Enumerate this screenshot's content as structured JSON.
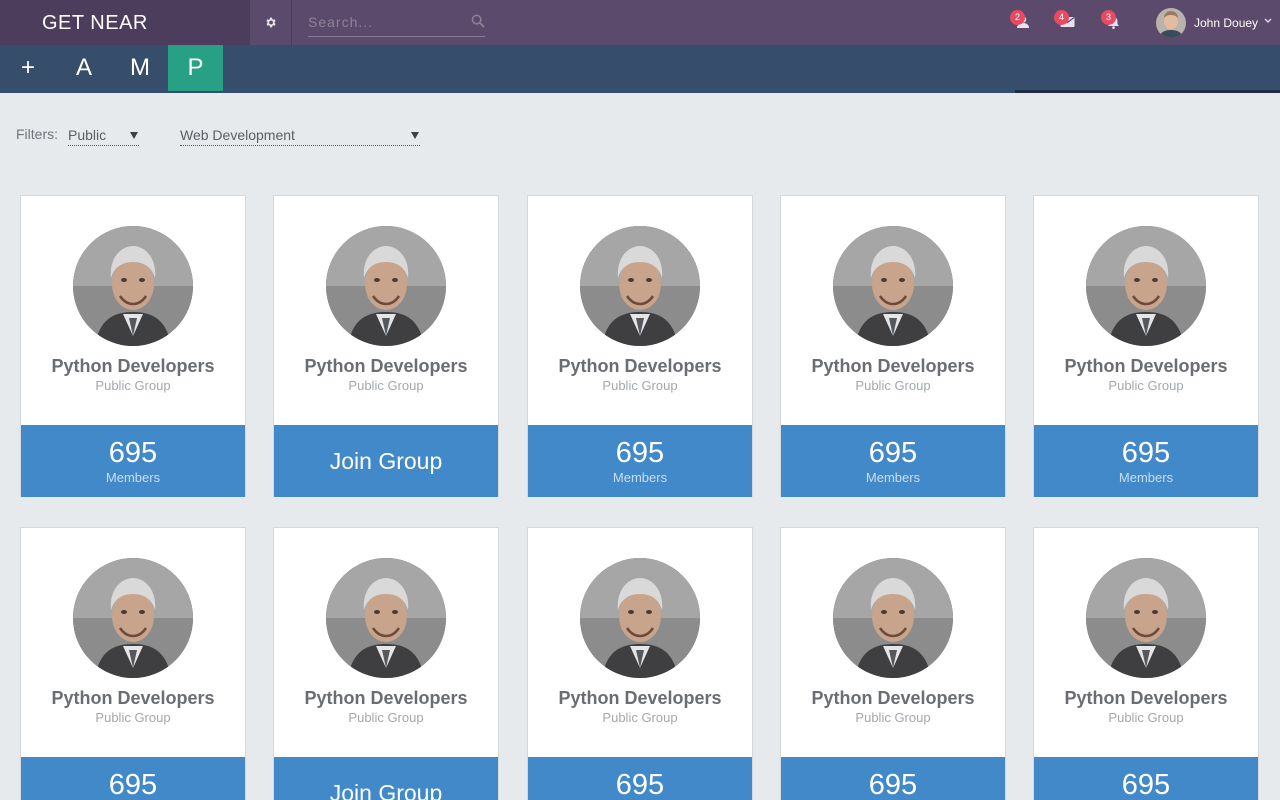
{
  "app": {
    "logo": "GET NEAR"
  },
  "search": {
    "placeholder": "Search..."
  },
  "notifications": [
    {
      "count": "2",
      "icon": "user-icon"
    },
    {
      "count": "4",
      "icon": "envelope-icon"
    },
    {
      "count": "3",
      "icon": "bell-icon"
    }
  ],
  "user": {
    "name": "John Douey"
  },
  "nav": [
    {
      "label": "+"
    },
    {
      "label": "A"
    },
    {
      "label": "M"
    },
    {
      "label": "P"
    }
  ],
  "filters": {
    "label": "Filters:",
    "visibility": "Public",
    "category": "Web Development"
  },
  "cards": [
    {
      "title": "Python Developers",
      "subtitle": "Public Group",
      "count": "695",
      "count_label": "Members"
    },
    {
      "title": "Python Developers",
      "subtitle": "Public Group",
      "action": "Join Group"
    },
    {
      "title": "Python Developers",
      "subtitle": "Public Group",
      "count": "695",
      "count_label": "Members"
    },
    {
      "title": "Python Developers",
      "subtitle": "Public Group",
      "count": "695",
      "count_label": "Members"
    },
    {
      "title": "Python Developers",
      "subtitle": "Public Group",
      "count": "695",
      "count_label": "Members"
    },
    {
      "title": "Python Developers",
      "subtitle": "Public Group",
      "count": "695"
    },
    {
      "title": "Python Developers",
      "subtitle": "Public Group",
      "action": "Join Group"
    },
    {
      "title": "Python Developers",
      "subtitle": "Public Group",
      "count": "695"
    },
    {
      "title": "Python Developers",
      "subtitle": "Public Group",
      "count": "695"
    },
    {
      "title": "Python Developers",
      "subtitle": "Public Group",
      "count": "695"
    }
  ]
}
